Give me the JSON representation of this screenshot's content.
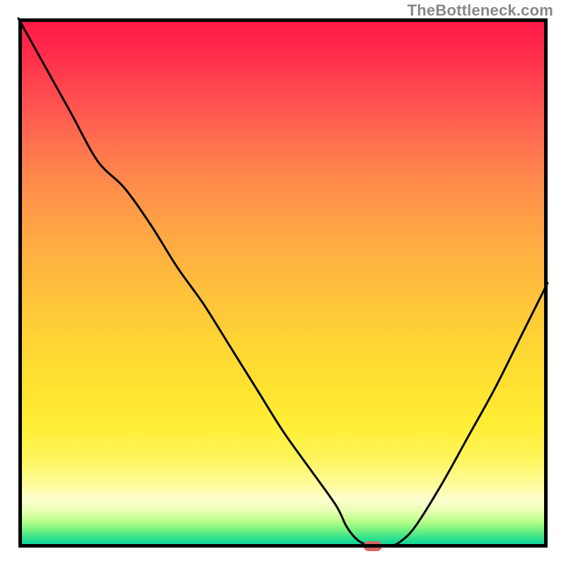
{
  "watermark": "TheBottleneck.com",
  "colors": {
    "frame": "#000000",
    "curve": "#000000",
    "marker": "#d2665e",
    "gradient_top": "#ff1846",
    "gradient_mid": "#ffd634",
    "gradient_bottom": "#10d69a"
  },
  "chart_data": {
    "type": "line",
    "title": "",
    "xlabel": "",
    "ylabel": "",
    "xlim": [
      0,
      100
    ],
    "ylim": [
      0,
      100
    ],
    "x": [
      0,
      5,
      10,
      15,
      20,
      25,
      30,
      35,
      40,
      45,
      50,
      55,
      60,
      62,
      64,
      66,
      68,
      70,
      72,
      75,
      80,
      85,
      90,
      95,
      100
    ],
    "values": [
      100,
      91,
      82,
      73,
      68,
      61,
      53,
      46,
      38,
      30,
      22,
      15,
      8,
      4,
      1.5,
      0.5,
      0.3,
      0.3,
      1,
      4,
      12,
      21,
      30,
      40,
      50
    ],
    "flat_range_x": [
      63,
      70
    ],
    "marker": {
      "x": 67,
      "y": 0.3
    }
  }
}
